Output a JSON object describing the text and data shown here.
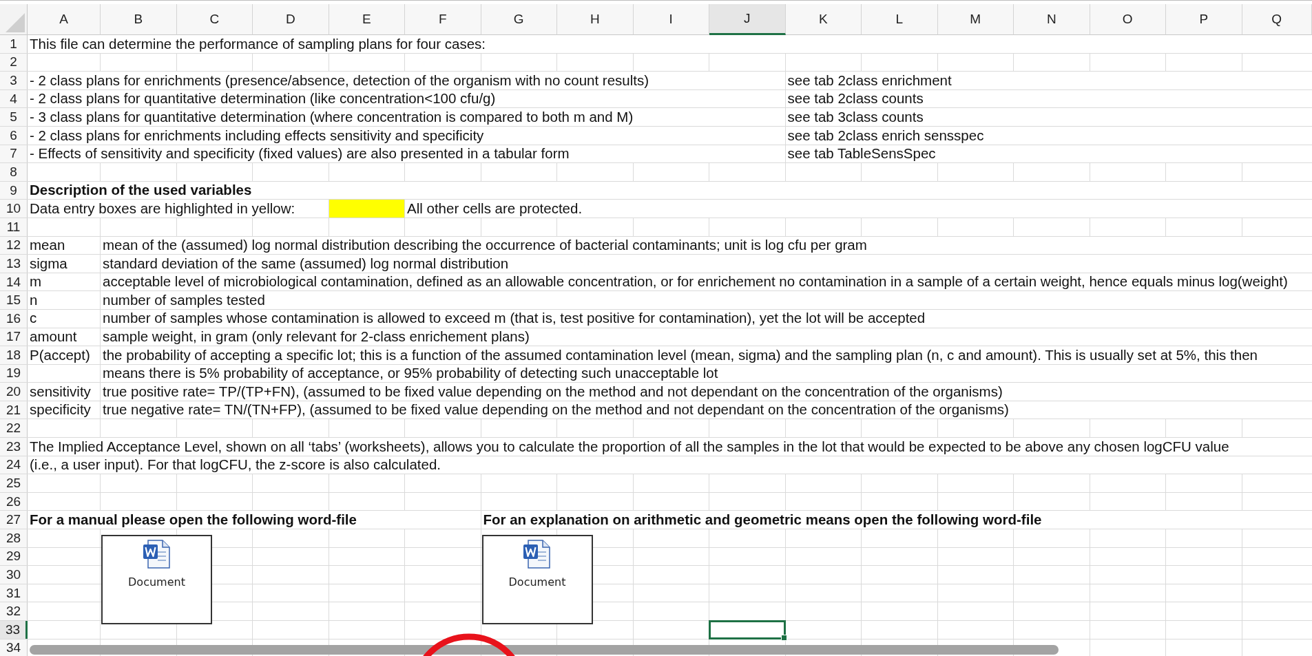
{
  "columns": [
    {
      "label": "A",
      "selected": false
    },
    {
      "label": "B",
      "selected": false
    },
    {
      "label": "C",
      "selected": false
    },
    {
      "label": "D",
      "selected": false
    },
    {
      "label": "E",
      "selected": false
    },
    {
      "label": "F",
      "selected": false
    },
    {
      "label": "G",
      "selected": false
    },
    {
      "label": "H",
      "selected": false
    },
    {
      "label": "I",
      "selected": false
    },
    {
      "label": "J",
      "selected": true
    },
    {
      "label": "K",
      "selected": false
    },
    {
      "label": "L",
      "selected": false
    },
    {
      "label": "M",
      "selected": false
    },
    {
      "label": "N",
      "selected": false
    },
    {
      "label": "O",
      "selected": false
    },
    {
      "label": "P",
      "selected": false
    },
    {
      "label": "Q",
      "selected": false
    }
  ],
  "rows": [
    {
      "number": "1",
      "selected": false,
      "cells": {
        "A": "This file can determine the performance of sampling plans for four cases:"
      }
    },
    {
      "number": "2",
      "selected": false
    },
    {
      "number": "3",
      "selected": false,
      "cells": {
        "A": "- 2 class plans for enrichments (presence/absence, detection of the organism with no count results)",
        "K": "see tab 2class enrichment"
      }
    },
    {
      "number": "4",
      "selected": false,
      "cells": {
        "A": "- 2 class plans for quantitative determination (like concentration<100 cfu/g)",
        "K": "see tab 2class counts"
      }
    },
    {
      "number": "5",
      "selected": false,
      "cells": {
        "A": "- 3 class plans for quantitative determination (where concentration is compared to both m and M)",
        "K": "see tab 3class counts"
      }
    },
    {
      "number": "6",
      "selected": false,
      "cells": {
        "A": "- 2 class plans for enrichments including effects sensitivity and specificity",
        "K": "see tab 2class enrich sensspec"
      }
    },
    {
      "number": "7",
      "selected": false,
      "cells": {
        "A": "- Effects of sensitivity and specificity (fixed values) are also presented in a tabular form",
        "K": "see tab TableSensSpec"
      }
    },
    {
      "number": "8",
      "selected": false
    },
    {
      "number": "9",
      "selected": false,
      "bold": true,
      "cells": {
        "A": "Description of the used variables"
      }
    },
    {
      "number": "10",
      "selected": false,
      "cells": {
        "A": "Data entry boxes are highlighted in yellow:",
        "E": {
          "highlighted": true
        },
        "F": "All other cells are protected."
      }
    },
    {
      "number": "11",
      "selected": false
    },
    {
      "number": "12",
      "selected": false,
      "cells": {
        "A": "mean",
        "B": "mean of the (assumed) log normal distribution describing the occurrence of bacterial contaminants; unit is log cfu per gram"
      }
    },
    {
      "number": "13",
      "selected": false,
      "cells": {
        "A": "sigma",
        "B": "standard deviation of the same (assumed) log normal distribution"
      }
    },
    {
      "number": "14",
      "selected": false,
      "cells": {
        "A": "m",
        "B": "acceptable level of microbiological contamination, defined as an allowable concentration, or for enrichement no contamination in a sample of a certain weight, hence equals minus log(weight)"
      }
    },
    {
      "number": "15",
      "selected": false,
      "cells": {
        "A": "n",
        "B": "number of samples tested"
      }
    },
    {
      "number": "16",
      "selected": false,
      "cells": {
        "A": "c",
        "B": "number of samples whose contamination is allowed to exceed m (that is, test positive for contamination), yet the lot will be accepted"
      }
    },
    {
      "number": "17",
      "selected": false,
      "cells": {
        "A": "amount",
        "B": "sample weight, in gram (only relevant for 2-class enrichement plans)"
      }
    },
    {
      "number": "18",
      "selected": false,
      "cells": {
        "A": "P(accept)",
        "B": "the probability of accepting a specific lot; this is a function of the assumed contamination level (mean, sigma) and the sampling plan (n, c and amount). This is usually set at 5%, this then"
      }
    },
    {
      "number": "19",
      "selected": false,
      "cells": {
        "B": "means there is 5% probability of acceptance, or 95% probability of detecting such unacceptable lot"
      }
    },
    {
      "number": "20",
      "selected": false,
      "cells": {
        "A": "sensitivity",
        "B": "true positive rate= TP/(TP+FN), (assumed to be fixed value depending on the method and not dependant on the concentration of the organisms)"
      }
    },
    {
      "number": "21",
      "selected": false,
      "cells": {
        "A": "specificity",
        "B": "true negative rate= TN/(TN+FP), (assumed to be fixed value depending on the method and not dependant on the concentration of the organisms)"
      }
    },
    {
      "number": "22",
      "selected": false
    },
    {
      "number": "23",
      "selected": false,
      "cells": {
        "A": "The Implied Acceptance Level, shown on all ‘tabs’ (worksheets), allows you to calculate the proportion of all the samples in the lot that would be expected to be above any chosen logCFU value"
      }
    },
    {
      "number": "24",
      "selected": false,
      "cells": {
        "A": "(i.e., a user input). For that logCFU, the z-score is also calculated."
      }
    },
    {
      "number": "25",
      "selected": false
    },
    {
      "number": "26",
      "selected": false
    },
    {
      "number": "27",
      "selected": false,
      "bold": true,
      "cells": {
        "A": "For a manual please open the following word-file",
        "G": "For an explanation on arithmetic and geometric means open the following word-file"
      }
    },
    {
      "number": "28",
      "selected": false
    },
    {
      "number": "29",
      "selected": false
    },
    {
      "number": "30",
      "selected": false
    },
    {
      "number": "31",
      "selected": false
    },
    {
      "number": "32",
      "selected": false
    },
    {
      "number": "33",
      "selected": true
    },
    {
      "number": "34",
      "selected": false
    }
  ],
  "embedded_objects": [
    {
      "label": "Document"
    },
    {
      "label": "Document"
    }
  ]
}
